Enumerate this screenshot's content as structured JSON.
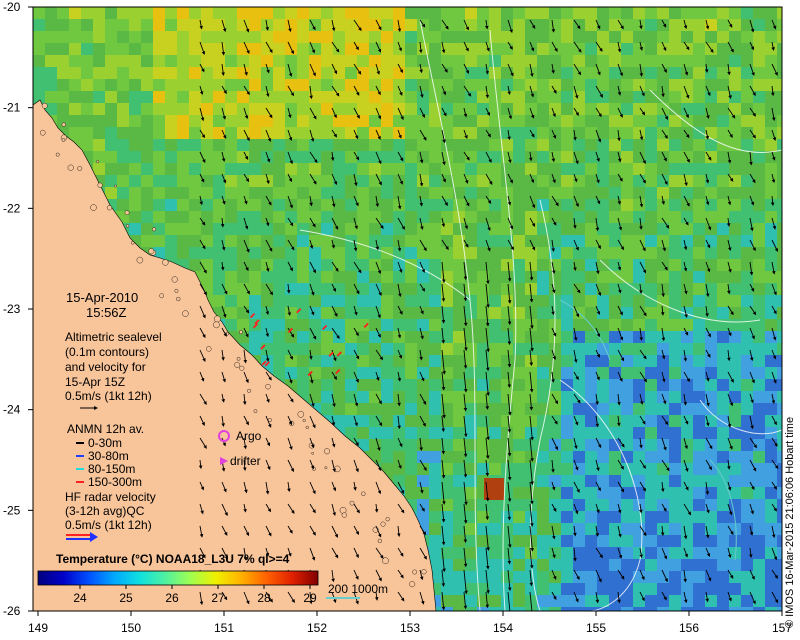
{
  "map": {
    "date": "15-Apr-2010",
    "time": "15:56Z",
    "altimetry_lines": [
      "Altimetric sealevel",
      "(0.1m contours)",
      "and velocity for",
      "15-Apr 15Z",
      "0.5m/s (1kt 12h)"
    ],
    "anmn_title": "ANMN 12h av.",
    "anmn_items": [
      {
        "label": "0-30m",
        "color": "#000000"
      },
      {
        "label": "30-80m",
        "color": "#1f3fff"
      },
      {
        "label": "80-150m",
        "color": "#22dddd"
      },
      {
        "label": "150-300m",
        "color": "#ff2020"
      }
    ],
    "argo_label": "Argo",
    "argo_color": "#e040e0",
    "drifter_label": "drifter",
    "drifter_color": "#e040e0",
    "hf_lines": [
      "HF radar velocity",
      "(3-12h avg)QC",
      "0.5m/s (1kt 12h)"
    ],
    "colorbar": {
      "title": "Temperature (°C) NOAA18_L3U 7% ql>=4",
      "ticks": [
        "24",
        "25",
        "26",
        "27",
        "28",
        "29"
      ],
      "colors": [
        "#00007f",
        "#0000c8",
        "#0050ff",
        "#00a8ff",
        "#10e0e0",
        "#50f0a0",
        "#a0ff50",
        "#f0f000",
        "#ffb000",
        "#ff6000",
        "#e02000",
        "#800000"
      ]
    },
    "depth_legend": "200  1000m",
    "depth_color": "#66cccc",
    "credit": "© IMOS 16-Mar-2015 21:06:06 Hobart time",
    "lat_ticks": [
      "-20",
      "-21",
      "-22",
      "-23",
      "-24",
      "-25",
      "-26"
    ],
    "lon_ticks": [
      "149",
      "150",
      "151",
      "152",
      "153",
      "154",
      "155",
      "156",
      "157"
    ],
    "colors": {
      "land": "#f8c49a",
      "ocean_base": "#6cc04a"
    }
  }
}
